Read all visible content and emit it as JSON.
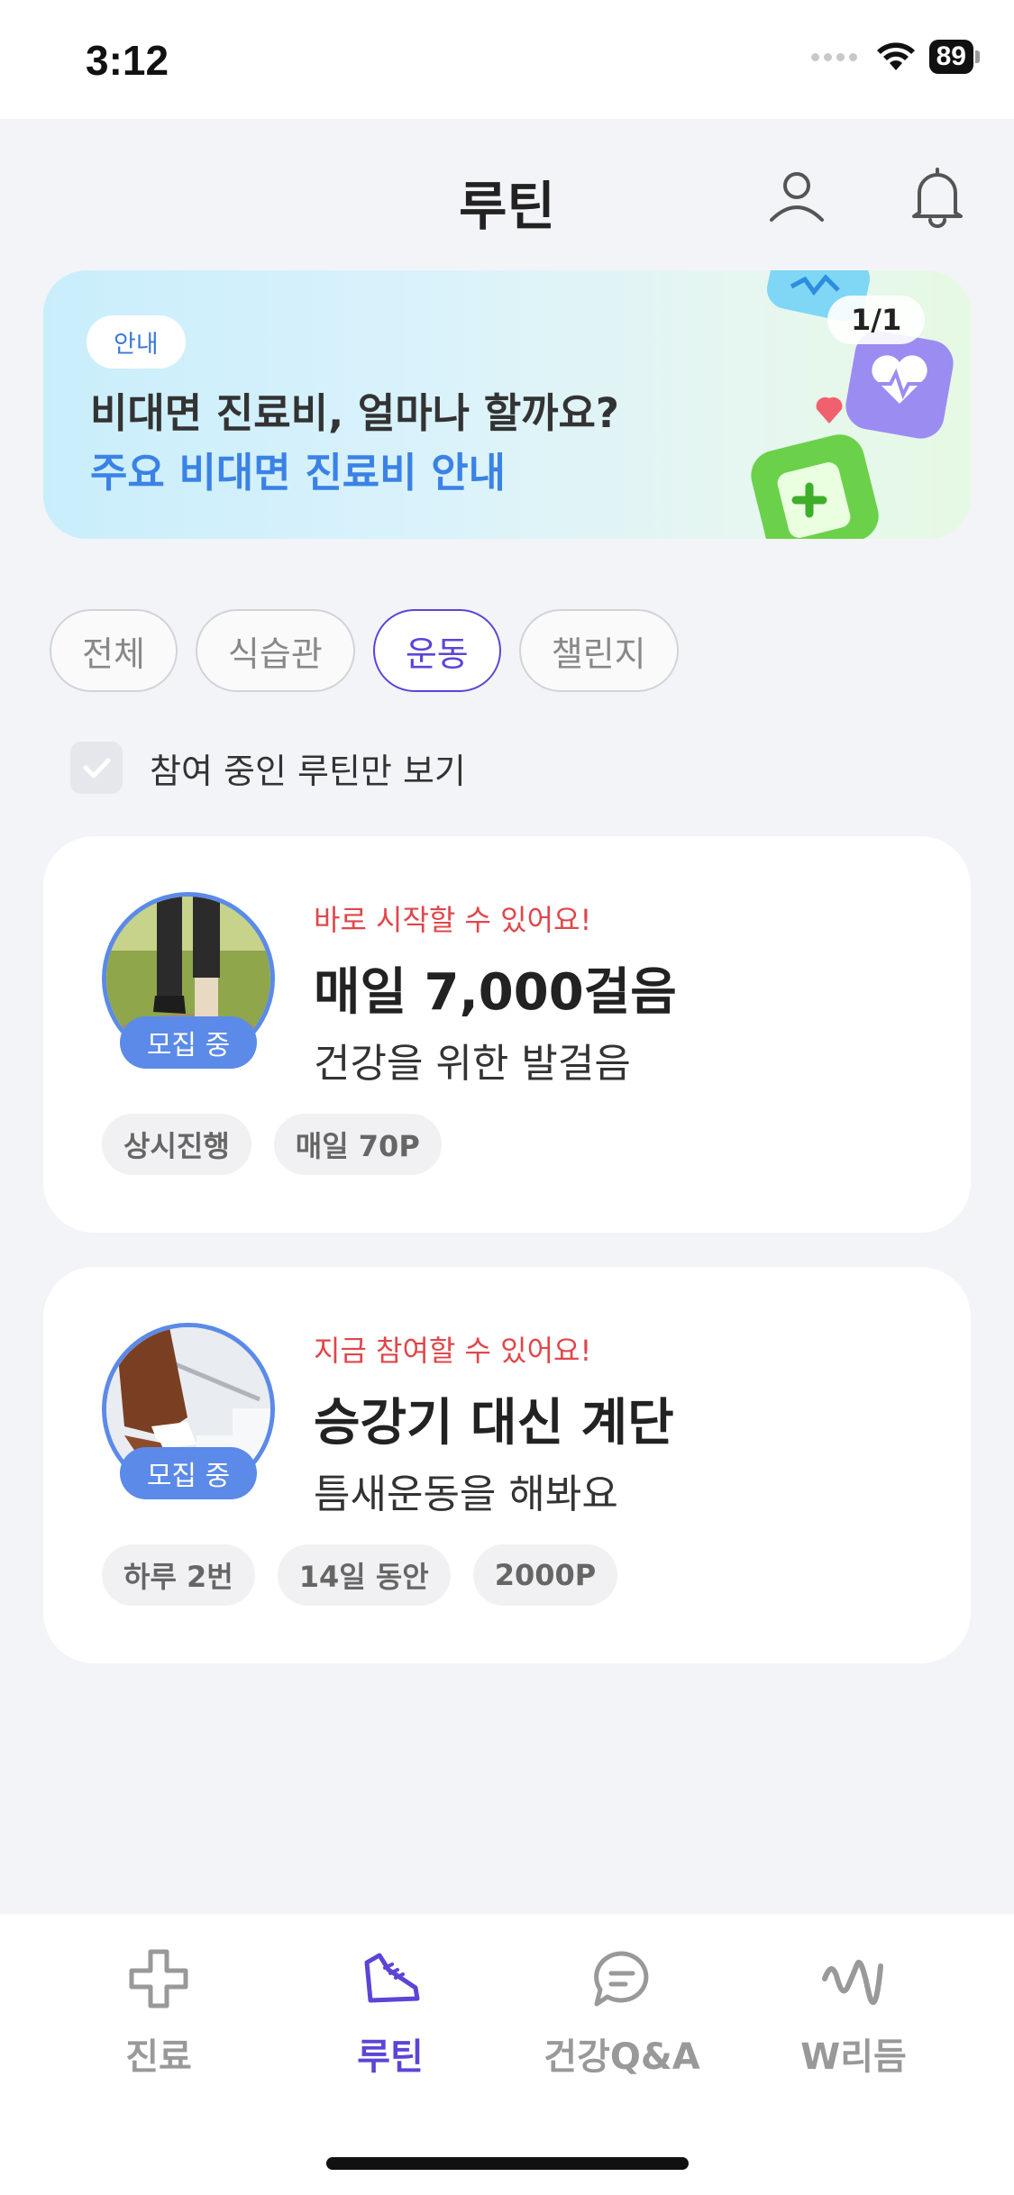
{
  "status_bar": {
    "time": "3:12",
    "battery": "89"
  },
  "header": {
    "title": "루틴"
  },
  "banner": {
    "tag": "안내",
    "line1": "비대면 진료비, 얼마나 할까요?",
    "line2": "주요 비대면 진료비 안내",
    "page": "1/1"
  },
  "filters": [
    {
      "label": "전체",
      "active": false
    },
    {
      "label": "식습관",
      "active": false
    },
    {
      "label": "운동",
      "active": true
    },
    {
      "label": "챌린지",
      "active": false
    }
  ],
  "only_joined": {
    "label": "참여 중인 루틴만 보기",
    "checked": false
  },
  "routines": [
    {
      "badge": "모집 중",
      "eyebrow": "바로 시작할 수 있어요!",
      "title": "매일 7,000걸음",
      "subtitle": "건강을 위한 발걸음",
      "tags": [
        "상시진행",
        "매일 70P"
      ]
    },
    {
      "badge": "모집 중",
      "eyebrow": "지금 참여할 수 있어요!",
      "title": "승강기 대신 계단",
      "subtitle": "틈새운동을 해봐요",
      "tags": [
        "하루 2번",
        "14일 동안",
        "2000P"
      ]
    }
  ],
  "tabbar": [
    {
      "label": "진료",
      "icon": "plus-cross-icon",
      "active": false
    },
    {
      "label": "루틴",
      "icon": "sneaker-icon",
      "active": true
    },
    {
      "label": "건강Q&A",
      "icon": "chat-bubble-icon",
      "active": false
    },
    {
      "label": "W리듬",
      "icon": "wave-icon",
      "active": false
    }
  ],
  "colors": {
    "accent": "#5b45d6",
    "recruit": "#5b8ae8",
    "highlight": "#e0464a",
    "banner_blue": "#3b82e6"
  }
}
